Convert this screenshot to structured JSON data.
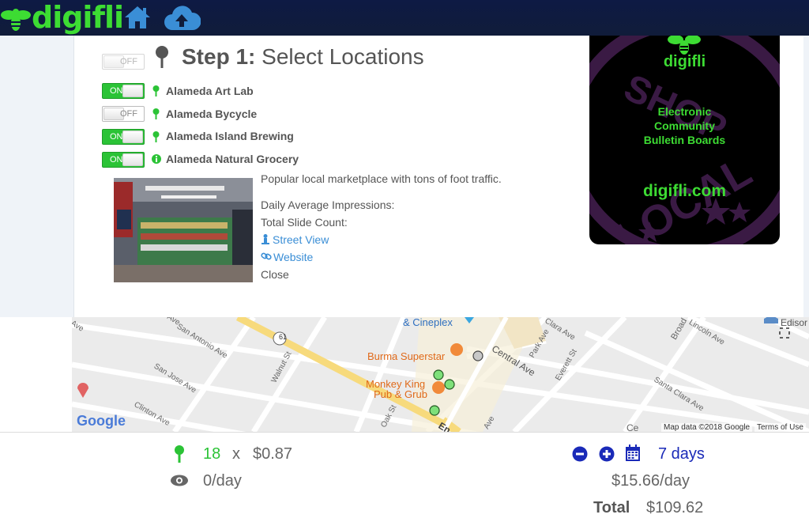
{
  "brand": {
    "name": "digifli"
  },
  "colors": {
    "brand_green": "#3ddc33",
    "nav_bg": "#0e1a44",
    "toggle_on": "#2bc336",
    "link": "#3a8ed6",
    "footer_blue": "#1a2ab8"
  },
  "nav": {
    "icons": [
      "home-icon",
      "cloud-upload-icon"
    ]
  },
  "step": {
    "toggle_label": "OFF",
    "title_bold": "Step 1:",
    "title_rest": " Select Locations"
  },
  "locations": [
    {
      "name": "Alameda Art Lab",
      "toggle": "ON",
      "icon": "pin-icon"
    },
    {
      "name": "Alameda Bycycle",
      "toggle": "OFF",
      "icon": "pin-icon"
    },
    {
      "name": "Alameda Island Brewing",
      "toggle": "ON",
      "icon": "pin-icon"
    },
    {
      "name": "Alameda Natural Grocery",
      "toggle": "ON",
      "icon": "info-icon"
    }
  ],
  "detail": {
    "description": "Popular local marketplace with tons of foot traffic.",
    "impressions_label": "Daily Average Impressions:",
    "slides_label": "Total Slide Count:",
    "street_view": "Street View",
    "website": "Website",
    "close": "Close"
  },
  "ad": {
    "brand": "digifli",
    "line1": "Electronic",
    "line2": "Community",
    "line3": "Bulletin Boards",
    "url": "digifli.com",
    "bg_text": "SHOP LOCAL"
  },
  "map": {
    "places": [
      "& Cineplex",
      "Burma Superstar",
      "Monkey King",
      "Pub & Grub",
      "Edisor"
    ],
    "streets": [
      "San Antonio Ave",
      "San Jose Ave",
      "Clinton Ave",
      "Walnut St",
      "Oak St",
      "Central Ave",
      "Park Ave",
      "Everett St",
      "Clara Ave",
      "Lincoln Ave",
      "Broad",
      "Santa Clara Ave",
      "Ave",
      "Ave",
      "Ave",
      "En",
      "Ce"
    ],
    "route_badge": "61",
    "attribution": "Map data ©2018 Google",
    "terms": "Terms of Use",
    "google": "Google"
  },
  "summary": {
    "locations_count": "18",
    "times": "x",
    "price_per": "$0.87",
    "impressions": "0/day",
    "days": "7 days",
    "daily_cost": "$15.66/day",
    "total_label": "Total",
    "total_value": "$109.62"
  }
}
